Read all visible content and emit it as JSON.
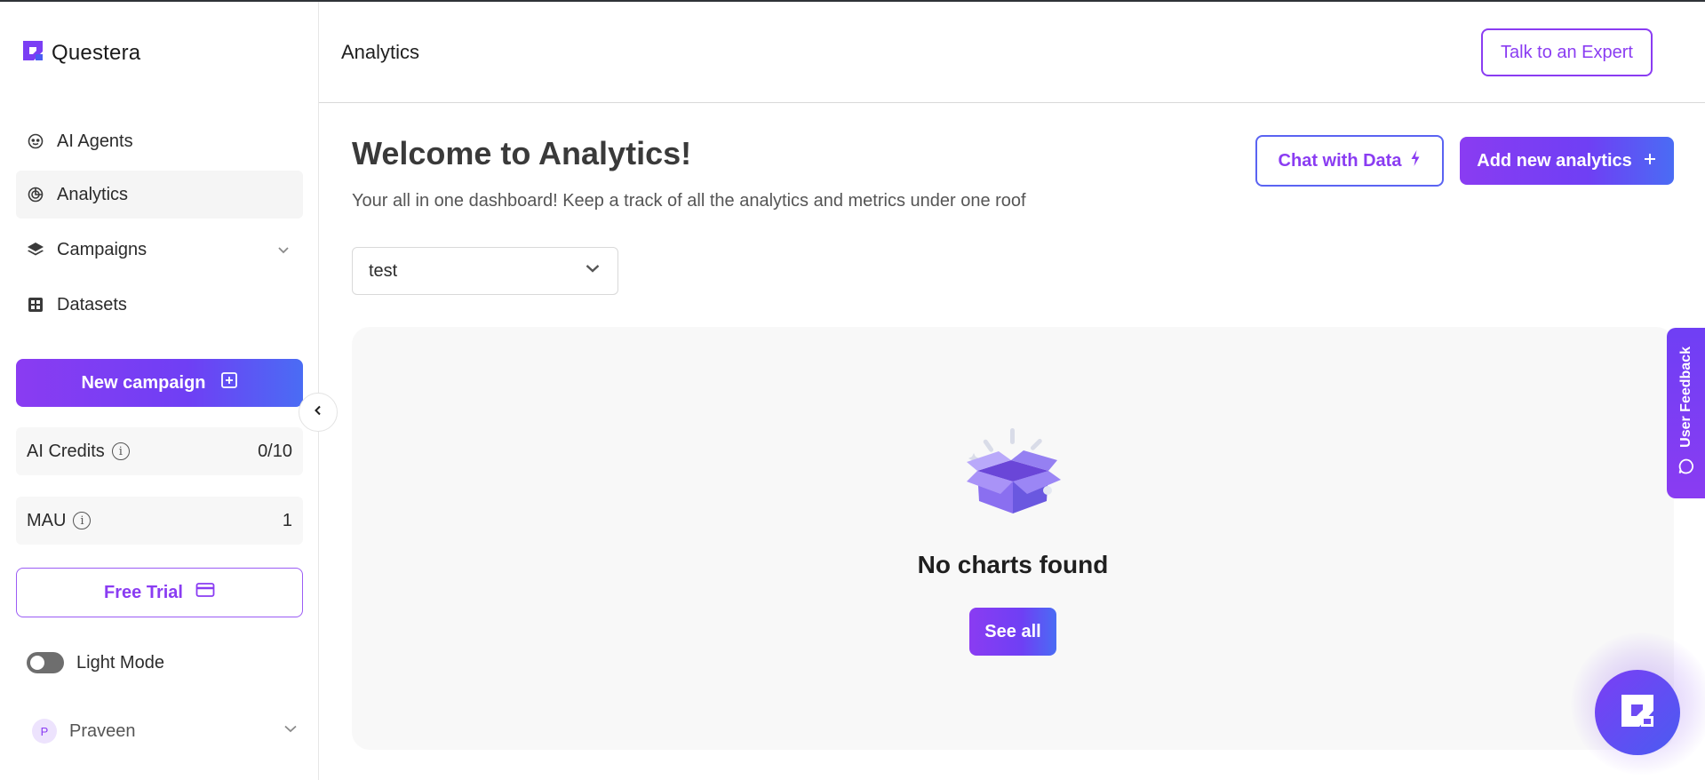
{
  "app": {
    "brand_name": "Questera",
    "accent_color": "#8a3cf2"
  },
  "sidebar": {
    "items": [
      {
        "label": "AI Agents",
        "icon": "robot-face-icon"
      },
      {
        "label": "Analytics",
        "icon": "analytics-icon",
        "active": true
      },
      {
        "label": "Campaigns",
        "icon": "layers-icon",
        "expandable": true
      },
      {
        "label": "Datasets",
        "icon": "grid-icon"
      }
    ],
    "new_campaign_label": "New campaign",
    "credits": {
      "label": "AI Credits",
      "value": "0/10"
    },
    "mau": {
      "label": "MAU",
      "value": "1"
    },
    "free_trial_label": "Free Trial",
    "theme_toggle_label": "Light Mode",
    "user": {
      "initial": "P",
      "name": "Praveen"
    }
  },
  "header": {
    "title": "Analytics",
    "expert_button_label": "Talk to an Expert"
  },
  "main": {
    "welcome_title": "Welcome to Analytics!",
    "subtitle": "Your all in one dashboard! Keep a track of all the analytics and metrics under one roof",
    "chat_button_label": "Chat with Data",
    "add_button_label": "Add new analytics",
    "dashboard_select": {
      "selected": "test"
    },
    "empty_state": {
      "title": "No charts found",
      "button_label": "See all"
    }
  },
  "feedback_tab": {
    "label": "User Feedback"
  }
}
